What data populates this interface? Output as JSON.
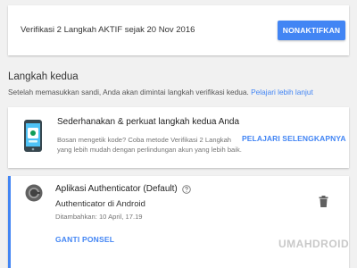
{
  "status": {
    "text": "Verifikasi 2 Langkah AKTIF sejak 20 Nov 2016",
    "disable_button": "NONAKTIFKAN"
  },
  "second_step": {
    "title": "Langkah kedua",
    "description": "Setelah memasukkan sandi, Anda akan dimintai langkah verifikasi kedua.",
    "learn_more": "Pelajari lebih lanjut"
  },
  "promo": {
    "icon": "phone-prompt-icon",
    "title": "Sederhanakan & perkuat langkah kedua Anda",
    "description": "Bosan mengetik kode? Coba metode Verifikasi 2 Langkah yang lebih mudah dengan perlindungan akun yang lebih baik.",
    "link": "PELAJARI SELENGKAPNYA"
  },
  "authenticator": {
    "icon": "authenticator-logo-icon",
    "title": "Aplikasi Authenticator (Default)",
    "subtitle": "Authenticator di Android",
    "added": "Ditambahkan: 10 April, 17.19",
    "change_button": "GANTI PONSEL"
  },
  "watermark": "UMAHDROID",
  "colors": {
    "accent": "#4285f4",
    "background": "#f1f1f1"
  }
}
